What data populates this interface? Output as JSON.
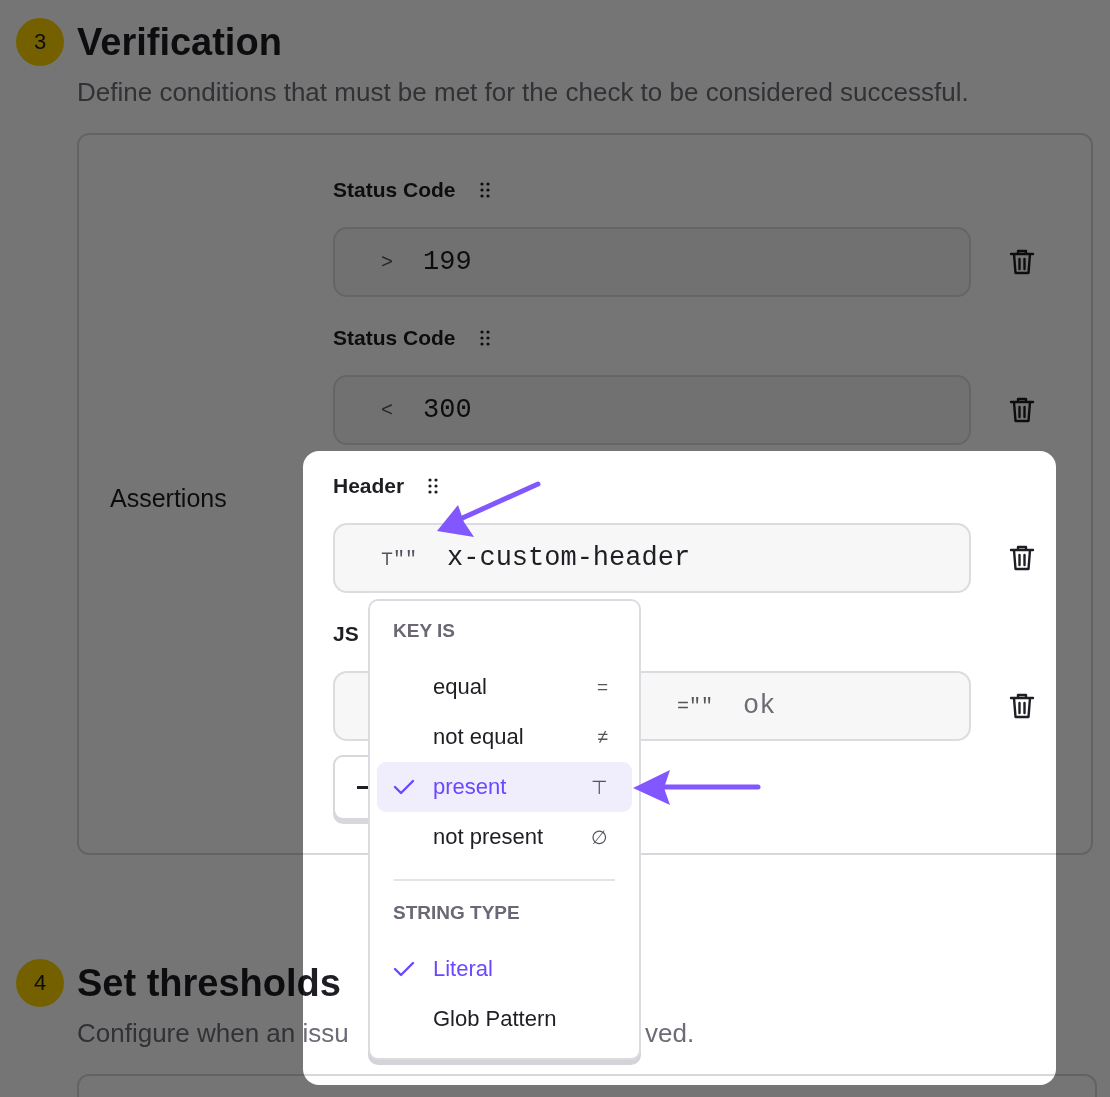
{
  "verification": {
    "number": "3",
    "title": "Verification",
    "description": "Define conditions that must be met for the check to be considered successful.",
    "card_label": "Assertions",
    "assertions": [
      {
        "label": "Status Code",
        "operator": ">",
        "value": "199"
      },
      {
        "label": "Status Code",
        "operator": "<",
        "value": "300"
      },
      {
        "label": "Header",
        "operator": "⊤\"\"",
        "value": "x-custom-header"
      },
      {
        "label": "JS",
        "operator": "=\"\"",
        "value": "ok"
      }
    ]
  },
  "thresholds": {
    "number": "4",
    "title": "Set thresholds",
    "description_parts": [
      "Configure when an issu",
      "ved."
    ]
  },
  "dropdown": {
    "groups": [
      {
        "heading": "KEY IS",
        "items": [
          {
            "label": "equal",
            "symbol": "=",
            "selected": false,
            "highlighted": false
          },
          {
            "label": "not equal",
            "symbol": "≠",
            "selected": false,
            "highlighted": false
          },
          {
            "label": "present",
            "symbol": "⊤",
            "selected": true,
            "highlighted": true
          },
          {
            "label": "not present",
            "symbol": "∅",
            "selected": false,
            "highlighted": false
          }
        ]
      },
      {
        "heading": "STRING TYPE",
        "items": [
          {
            "label": "Literal",
            "selected": true,
            "highlighted": false
          },
          {
            "label": "Glob Pattern",
            "selected": false,
            "highlighted": false
          }
        ]
      }
    ]
  }
}
